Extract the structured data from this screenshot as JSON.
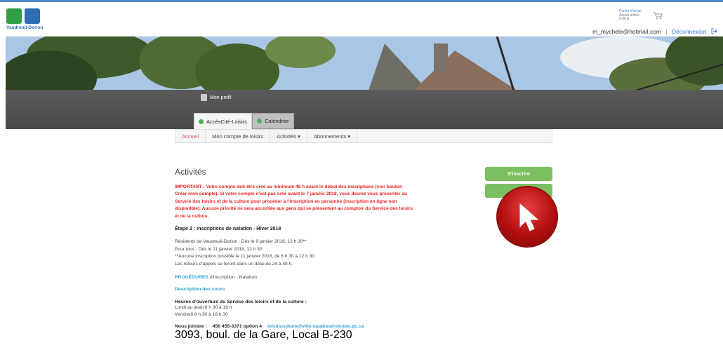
{
  "header": {
    "logo_text": "Vaudreuil-Dorion",
    "cart": {
      "title": "Panier d'achat",
      "items": "Aucun article",
      "total": "0.00 $"
    },
    "user_email": "m_mychele@hotmail.com",
    "separator": "|",
    "logout_label": "Déconnexion"
  },
  "profile_label": "Mon profil",
  "tabs": [
    {
      "label": "AccèsCité-Loisirs"
    },
    {
      "label": "Calendrier"
    }
  ],
  "nav": [
    {
      "label": "Accueil"
    },
    {
      "label": "Mon compte de loisirs"
    },
    {
      "label": "Activités ▾"
    },
    {
      "label": "Abonnements ▾"
    }
  ],
  "main": {
    "title": "Activités",
    "important": "IMPORTANT : Votre compte doit être créé au minimum 48 h avant le début des inscriptions (voir bouton Créer mon compte). Si votre compte n'est pas créé avant le 7 janvier 2018, vous devrez vous présenter au Service des loisirs et de la culture pour procéder à l'inscription en personne (inscription en ligne non disponible). Aucune priorité ne sera accordée aux gens qui se présentent au comptoir du Service des loisirs et de la culture.",
    "etape": "Étape 2 : Inscriptions de natation - Hiver 2018",
    "dates": [
      "Résidents de Vaudreuil-Dorion : Dès le 9 janvier 2018, 12 h 30**",
      "Pour tous : Dès le 11 janvier 2018, 12 h 30",
      "**Aucune inscription possible le 11 janvier 2018, de 8 h 30 à 12 h 30",
      "Les retours d'appels se feront dans un délai de 24 à 48 h."
    ],
    "procedures_link": "PROCÉDURES",
    "procedures_text": " d'inscription - Natation",
    "description_link": "Description des cours",
    "hours_title": "Heures d'ouverture du Service des loisirs et de la culture :",
    "hours": [
      "Lundi au jeudi 8 h 30 à 18 h",
      "Vendredi 8 h 30 à 16 h 30"
    ],
    "contact_label": "Nous joindre :",
    "phone": "450 455-3371 option 4",
    "email": "loisirsculture@ville.vaudreuil-dorion.qc.ca",
    "address": "3093, boul. de la Gare, Local B-230"
  },
  "side": {
    "inscrire_label": "S'inscrire"
  },
  "colors": {
    "accent_green": "#7cbf60",
    "important_red": "#e22222",
    "link_blue": "#2a9fd6",
    "menu_grey": "#4a4a4a"
  }
}
